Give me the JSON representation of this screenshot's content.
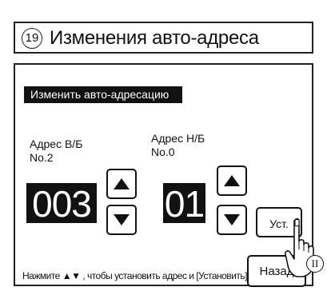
{
  "header": {
    "step_number": "19",
    "title": "Изменения авто-адреса"
  },
  "section": {
    "label": "Изменить авто-адресацию"
  },
  "indoor": {
    "label_line1": "Адрес В/Б",
    "label_line2": "No.2",
    "value": "003"
  },
  "outdoor": {
    "label_line1": "Адрес Н/Б",
    "label_line2": "No.0",
    "value": "01"
  },
  "buttons": {
    "set_label": "Уст.",
    "back_label": "Назад"
  },
  "hint": "Нажмите ▲▼ , чтобы установить адрес и [Установить].",
  "icons": {
    "up": "triangle-up-icon",
    "down": "triangle-down-icon",
    "hand": "pointing-hand-icon"
  },
  "hand_badge": "II"
}
